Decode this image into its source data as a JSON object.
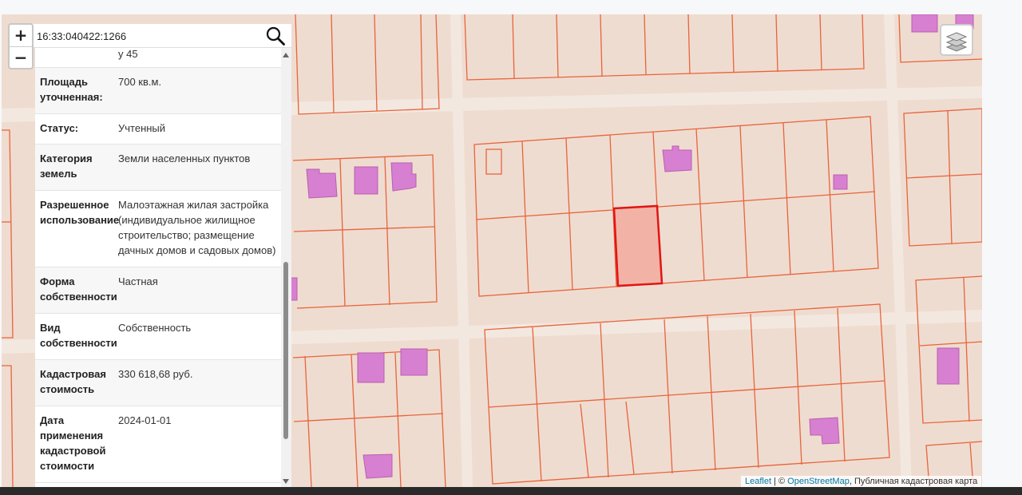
{
  "search": {
    "value": "16:33:040422:1266",
    "placeholder": "",
    "icon": "search-icon"
  },
  "zoom": {
    "in_label": "+",
    "out_label": "−"
  },
  "info": {
    "top_partial": "у 45",
    "rows": [
      {
        "key": "Площадь уточненная:",
        "value": "700 кв.м."
      },
      {
        "key": "Статус:",
        "value": "Учтенный"
      },
      {
        "key": "Категория земель",
        "value": "Земли населенных пунктов"
      },
      {
        "key": "Разрешенное использование",
        "value": "Малоэтажная жилая застройка (индивидуальное жилищное строительство; размещение дачных домов и садовых домов)"
      },
      {
        "key": "Форма собственности",
        "value": "Частная"
      },
      {
        "key": "Вид собственности",
        "value": "Собственность"
      },
      {
        "key": "Кадастровая стоимость",
        "value": "330 618,68 руб."
      },
      {
        "key": "Дата применения кадастровой стоимости",
        "value": "2024-01-01"
      }
    ]
  },
  "layers": {
    "icon": "layers-icon"
  },
  "attribution": {
    "leaflet": "Leaflet",
    "separator": " | © ",
    "osm": "OpenStreetMap",
    "rest": ", Публичная кадастровая карта"
  },
  "colors": {
    "map_bg": "#efdcd0",
    "parcel_line": "#e8643c",
    "building": "#d77fd0",
    "selected_fill": "#f2b3a6",
    "selected_stroke": "#e11414",
    "road": "#f3e8e0"
  }
}
